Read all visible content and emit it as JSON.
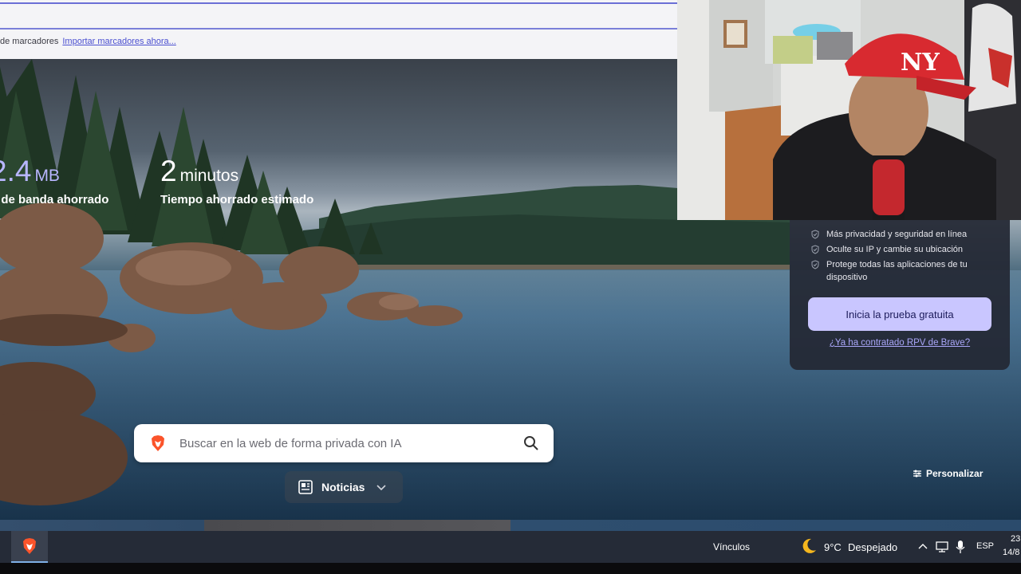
{
  "bookmarks_bar": {
    "text": "de marcadores",
    "import_link": "Importar marcadores ahora..."
  },
  "stats": {
    "bandwidth_value": "2.4",
    "bandwidth_unit": "MB",
    "bandwidth_label": "o de banda ahorrado",
    "time_value": "2",
    "time_unit": "minutos",
    "time_label": "Tiempo ahorrado estimado"
  },
  "search": {
    "placeholder": "Buscar en la web de forma privada con IA"
  },
  "news": {
    "label": "Noticias"
  },
  "customize": {
    "label": "Personalizar"
  },
  "vpn_panel": {
    "features": [
      "Más privacidad y seguridad en línea",
      "Oculte su IP y cambie su ubicación",
      "Protege todas las aplicaciones de tu dispositivo"
    ],
    "trial_button": "Inicia la prueba gratuita",
    "already_link": "¿Ya ha contratado RPV de Brave?"
  },
  "taskbar": {
    "links": "Vínculos",
    "temperature": "9°C",
    "weather": "Despejado",
    "language": "ESP",
    "time": "23",
    "date": "14/8"
  },
  "colors": {
    "accent": "#b8b6ff",
    "trial_button": "#c9c6ff",
    "brave": "#fb542b"
  },
  "icons": {
    "search_brave": "brave-lion-icon",
    "search_submit": "magnifier-icon",
    "news": "newspaper-icon",
    "customize": "sliders-icon",
    "weather": "moon-icon"
  }
}
